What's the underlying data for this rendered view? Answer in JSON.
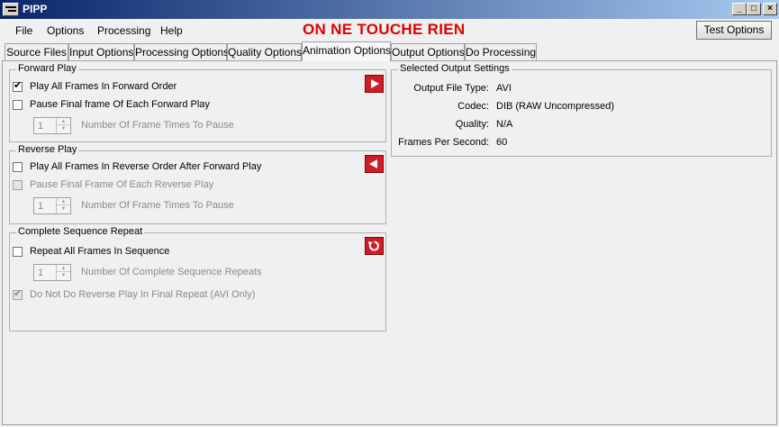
{
  "window": {
    "title": "PIPP"
  },
  "menu": {
    "items": [
      "File",
      "Options",
      "Processing",
      "Help"
    ]
  },
  "banner": "ON NE TOUCHE RIEN",
  "test_options_label": "Test Options",
  "tabs": [
    "Source Files",
    "Input Options",
    "Processing Options",
    "Quality Options",
    "Animation Options",
    "Output Options",
    "Do Processing"
  ],
  "active_tab": "Animation Options",
  "forward_play": {
    "title": "Forward Play",
    "play_all_label": "Play All Frames In Forward Order",
    "play_all_checked": true,
    "pause_final_label": "Pause Final frame Of Each Forward Play",
    "pause_final_checked": false,
    "spin_value": "1",
    "spin_label": "Number Of Frame Times To Pause"
  },
  "reverse_play": {
    "title": "Reverse Play",
    "play_all_label": "Play All Frames In Reverse Order After Forward Play",
    "play_all_checked": false,
    "pause_final_label": "Pause Final Frame Of Each Reverse Play",
    "pause_final_checked": false,
    "spin_value": "1",
    "spin_label": "Number Of Frame Times To Pause"
  },
  "sequence_repeat": {
    "title": "Complete Sequence Repeat",
    "repeat_label": "Repeat All Frames In Sequence",
    "repeat_checked": false,
    "spin_value": "1",
    "spin_label": "Number Of Complete Sequence Repeats",
    "no_reverse_label": "Do Not Do Reverse Play In Final Repeat (AVI Only)",
    "no_reverse_checked": true
  },
  "output_settings": {
    "title": "Selected Output Settings",
    "rows": [
      {
        "key": "Output File Type:",
        "value": "AVI"
      },
      {
        "key": "Codec:",
        "value": "DIB (RAW Uncompressed)"
      },
      {
        "key": "Quality:",
        "value": "N/A"
      },
      {
        "key": "Frames Per Second:",
        "value": "60"
      }
    ]
  },
  "colors": {
    "banner": "#e00000",
    "action_button": "#cc1e2a"
  },
  "icons": [
    "play-forward-icon",
    "play-reverse-icon",
    "repeat-icon",
    "minimize-icon",
    "maximize-icon",
    "close-icon"
  ]
}
